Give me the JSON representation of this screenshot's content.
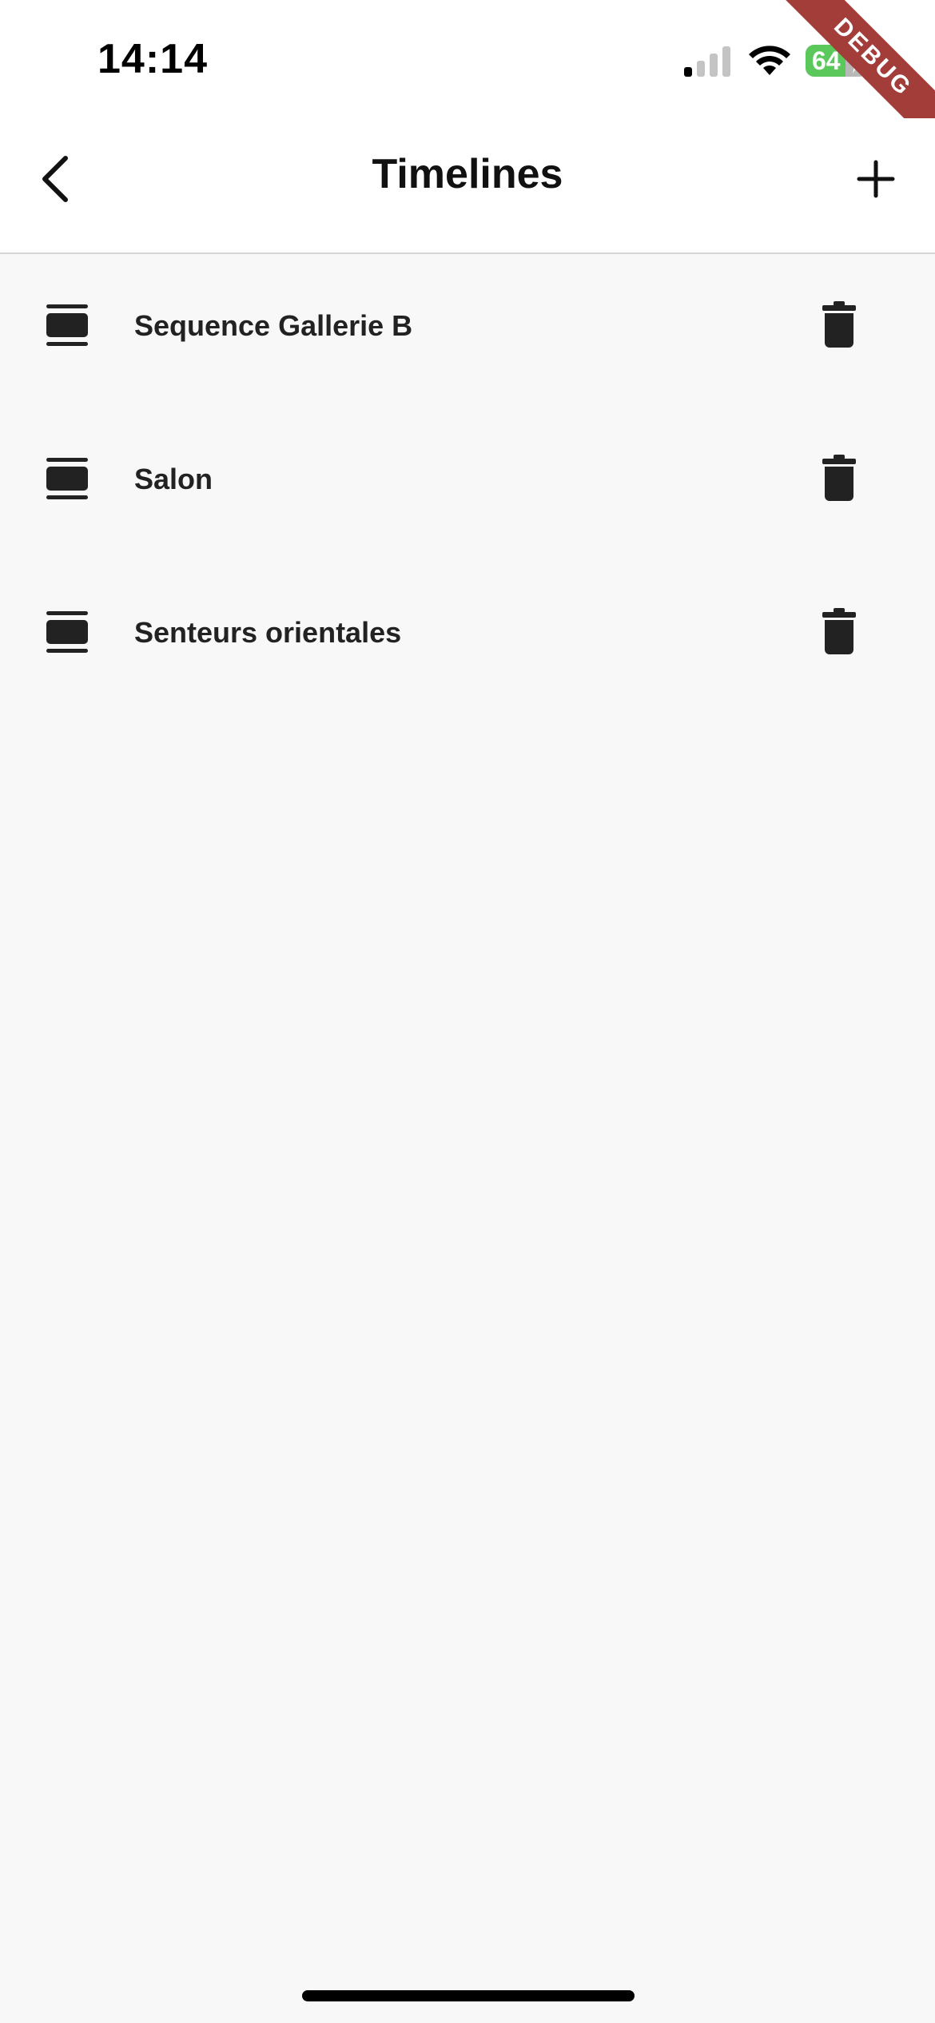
{
  "status_bar": {
    "time": "14:14",
    "battery_percent": "64",
    "battery_level": 0.64,
    "signal_icon": "cellular-signal-icon",
    "wifi_icon": "wifi-icon",
    "charging_icon": "charging-bolt-icon"
  },
  "debug_banner": {
    "label": "DEBUG",
    "color": "#a23d3a"
  },
  "nav": {
    "title": "Timelines",
    "back_icon": "chevron-left-icon",
    "add_icon": "plus-icon"
  },
  "timelines": [
    {
      "label": "Sequence Gallerie B",
      "icon": "timeline-icon",
      "delete_icon": "trash-icon"
    },
    {
      "label": "Salon",
      "icon": "timeline-icon",
      "delete_icon": "trash-icon"
    },
    {
      "label": "Senteurs orientales",
      "icon": "timeline-icon",
      "delete_icon": "trash-icon"
    }
  ],
  "colors": {
    "background": "#f8f8f8",
    "surface": "#ffffff",
    "icon": "#222222",
    "battery_fill": "#5ac85a"
  }
}
